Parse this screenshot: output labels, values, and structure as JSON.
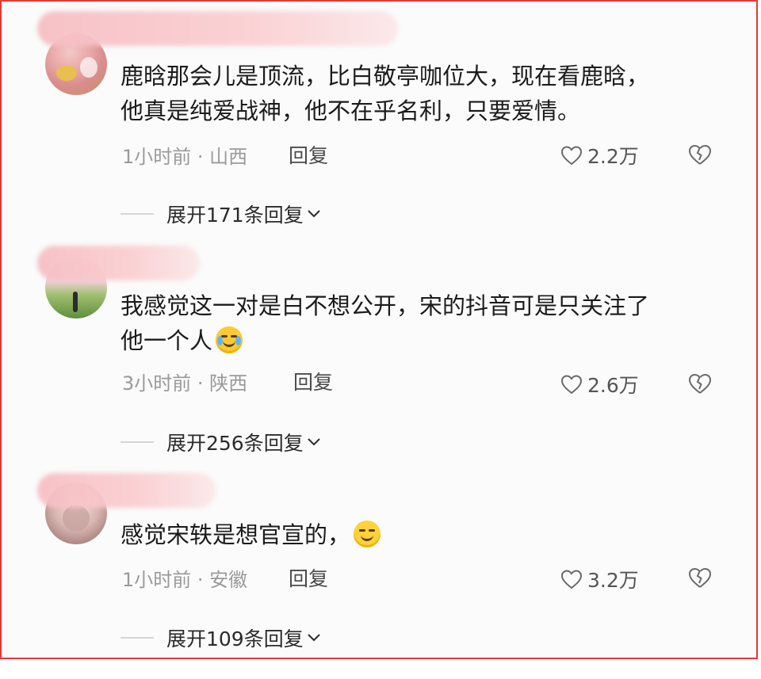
{
  "comments": [
    {
      "text_lines": [
        "鹿晗那会儿是顶流，比白敬亭咖位大，现在看鹿晗，",
        "他真是纯爱战神，他不在乎名利，只要爱情。"
      ],
      "emoji": "",
      "meta": "1小时前 · 山西",
      "reply_label": "回复",
      "likes": "2.2万",
      "expand_label": "展开171条回复"
    },
    {
      "text_lines": [
        "我感觉这一对是白不想公开，宋的抖音可是只关注了",
        "他一个人"
      ],
      "emoji": "laughing-crying-emoji",
      "meta": "3小时前 · 陕西",
      "reply_label": "回复",
      "likes": "2.6万",
      "expand_label": "展开256条回复"
    },
    {
      "text_lines": [
        "感觉宋轶是想官宣的，"
      ],
      "emoji": "smug-face-emoji",
      "meta": "1小时前 · 安徽",
      "reply_label": "回复",
      "likes": "3.2万",
      "expand_label": "展开109条回复"
    }
  ],
  "colors": {
    "border": "#e53935",
    "meta_text": "#9a9a9a",
    "name_mask": "#f6bec3",
    "emoji": "#ffd13b"
  },
  "icons": [
    "heart-outline-icon",
    "broken-heart-icon",
    "chevron-down-icon"
  ]
}
